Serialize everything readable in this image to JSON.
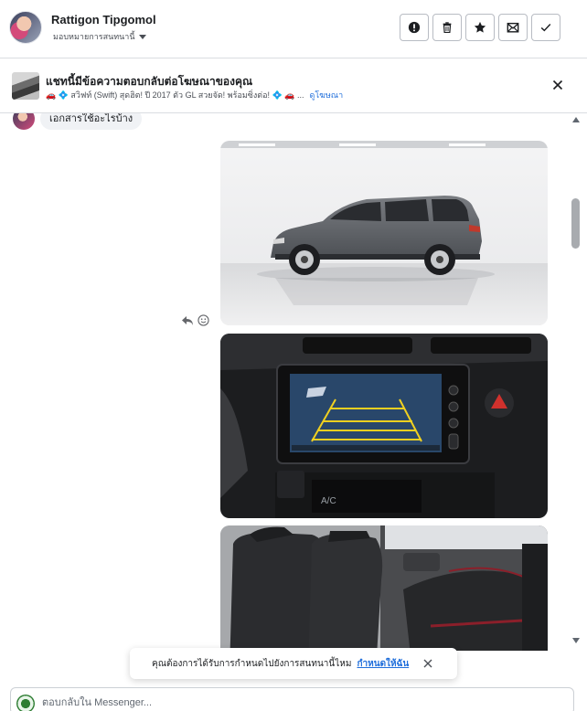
{
  "header": {
    "contact_name": "Rattigon Tipgomol",
    "assign_label": "มอบหมายการสนทนานี้",
    "actions": [
      {
        "name": "report-icon",
        "label": "Report"
      },
      {
        "name": "trash-icon",
        "label": "Delete"
      },
      {
        "name": "star-icon",
        "label": "Star"
      },
      {
        "name": "mail-unread-icon",
        "label": "Mark unread"
      },
      {
        "name": "check-icon",
        "label": "Done"
      }
    ]
  },
  "ad_banner": {
    "title": "แชทนี้มีข้อความตอบกลับต่อโฆษณาของคุณ",
    "ad_text": "🚗 💠 สวิฟท์ (Swift) สุดฮิต! ปี 2017 ตัว GL สวยจัด! พร้อมซิ่งต่อ! 💠 🚗 ...",
    "view_ad_link": "ดูโฆษณา"
  },
  "conversation": {
    "incoming_message": "เอกสารใช้อะไรบ้าง",
    "photos": [
      {
        "name": "car-side-photo",
        "subject": "grey SUV side view"
      },
      {
        "name": "car-dashboard-photo",
        "subject": "dashboard screen with reverse camera"
      },
      {
        "name": "car-seats-photo",
        "subject": "rear seats interior"
      }
    ]
  },
  "toast": {
    "text": "คุณต้องการได้รับการกำหนดไปยังการสนทนานี้ไหม",
    "link": "กำหนดให้ฉัน"
  },
  "reply_box": {
    "placeholder": "ตอบกลับใน Messenger..."
  },
  "colors": {
    "link_blue": "#216fdb",
    "border_grey": "#dadde1",
    "bubble_bg": "#f0f2f5"
  }
}
